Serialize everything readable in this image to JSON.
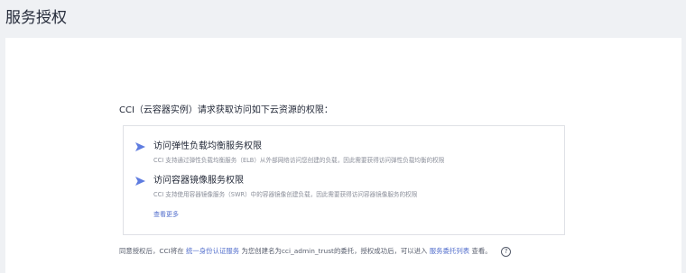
{
  "page": {
    "title": "服务授权"
  },
  "main": {
    "request_text": "CCI（云容器实例）请求获取访问如下云资源的权限：",
    "permissions": [
      {
        "title": "访问弹性负载均衡服务权限",
        "description": "CCI 支持通过弹性负载均衡服务（ELB）从外部网络访问您创建的负载，因此需要获得访问弹性负载均衡的权限"
      },
      {
        "title": "访问容器镜像服务权限",
        "description": "CCI 支持使用容器镜像服务（SWR）中的容器镜像创建负载，因此需要获得访问容器镜像服务的权限"
      }
    ],
    "view_more": "查看更多"
  },
  "footer": {
    "text_1": "同意授权后，CCI将在",
    "link_iam": "统一身份认证服务",
    "text_2": "为您创建名为cci_admin_trust的委托，授权成功后，可以进入",
    "link_agency": "服务委托列表",
    "text_3": "查看。",
    "help_glyph": "?"
  },
  "colors": {
    "background": "#eff1f4",
    "card": "#ffffff",
    "link": "#526ecc",
    "arrow": "#5e7ce0"
  },
  "icons": {
    "arrow": "arrow-right-icon",
    "help": "question-circle-icon"
  }
}
